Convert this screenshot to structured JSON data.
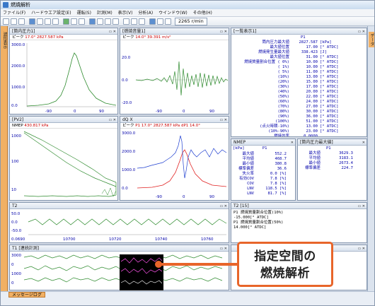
{
  "window": {
    "title": "燃焼解析"
  },
  "menu": [
    "ファイル(F)",
    "ハードウエア設定(E)",
    "運転(S)",
    "計測(M)",
    "表示(V)",
    "分析(A)",
    "ウインドウ(W)",
    "その他(H)"
  ],
  "toolbar": {
    "rpm": "2265 r/min"
  },
  "side_tabs": {
    "left": "波形表示",
    "right": "データ"
  },
  "panes": {
    "pressure": {
      "title": "[筒内圧力1]",
      "info_peak": "ピーク",
      "info_deg": "17.0°",
      "info_val": "2827.587 kPa",
      "y_ticks": [
        "3000.0",
        "2000.0",
        "1000.0",
        "0.0"
      ],
      "x_ticks": [
        "-90",
        "0",
        "90"
      ]
    },
    "vibration": {
      "title": "[燃焼音量1]",
      "info_peak": "ピーク",
      "info_deg": "14.0°",
      "info_val": "39.391 m/s²",
      "y_ticks": [
        "20.0",
        "0.0",
        "-20.0"
      ],
      "x_ticks": [
        "-90",
        "0",
        "90"
      ]
    },
    "pv": {
      "title": "[PV2]",
      "info_peak": "NMEP",
      "info_val": "430.817 kPa",
      "y_ticks": [
        "1000",
        "100",
        "10"
      ]
    },
    "dqx": {
      "title": "dQ X",
      "info_peak": "ピーク",
      "info_p1": "P1",
      "info_deg": "17.0°",
      "info_val": "2827.587 kPa",
      "info_dp": "dP1",
      "info_deg2": "14.0°",
      "y_ticks": [
        "3000.0",
        "2000.0",
        "1000.0",
        "0.0"
      ],
      "x_ticks": [
        "-90",
        "0",
        "90"
      ]
    },
    "t2": {
      "title": "T2",
      "y_ticks": [
        "50.0",
        "0.0",
        "-50.0"
      ],
      "x_ticks": [
        "0.0690",
        "10700",
        "10720",
        "10740",
        "10760"
      ]
    },
    "tlong": {
      "title": "T1 [連続計測]",
      "y_ticks": [
        "3000",
        "0",
        "1000",
        "0"
      ]
    },
    "list": {
      "title": "[一覧表示1]",
      "col": "P1"
    },
    "nmep": {
      "title": "NMEP",
      "col_unit": "[kPa]",
      "col": "P1"
    },
    "maxp": {
      "title": "[筒内圧力最大値]",
      "col": "P1"
    },
    "t2text": {
      "title": "T2 [15]"
    },
    "t2text2": {
      "title": ""
    }
  },
  "list_rows": [
    {
      "label": "筒内圧力最大値",
      "value": "2827.587",
      "unit": "[kPa]"
    },
    {
      "label": "最大値位置",
      "value": "17.00",
      "unit": "[° ATDC]"
    },
    {
      "label": "燃焼発生量最大値",
      "value": "338.423",
      "unit": "[J]"
    },
    {
      "label": "最大値位置",
      "value": "31.00",
      "unit": "[° ATDC]"
    },
    {
      "label": "燃焼質量割合位置 ( 0%)",
      "value": "10.00",
      "unit": "[° ATDC]"
    },
    {
      "label": "( 1%)",
      "value": "10.00",
      "unit": "[° ATDC]"
    },
    {
      "label": "( 5%)",
      "value": "11.00",
      "unit": "[° ATDC]"
    },
    {
      "label": "(10%)",
      "value": "13.00",
      "unit": "[° ATDC]"
    },
    {
      "label": "(20%)",
      "value": "15.00",
      "unit": "[° ATDC]"
    },
    {
      "label": "(30%)",
      "value": "17.00",
      "unit": "[° ATDC]"
    },
    {
      "label": "(40%)",
      "value": "20.00",
      "unit": "[° ATDC]"
    },
    {
      "label": "(50%)",
      "value": "22.00",
      "unit": "[° ATDC]"
    },
    {
      "label": "(60%)",
      "value": "24.00",
      "unit": "[° ATDC]"
    },
    {
      "label": "(70%)",
      "value": "27.00",
      "unit": "[° ATDC]"
    },
    {
      "label": "(80%)",
      "value": "30.00",
      "unit": "[° ATDC]"
    },
    {
      "label": "(90%)",
      "value": "36.00",
      "unit": "[° ATDC]"
    },
    {
      "label": "(100%)",
      "value": "51.00",
      "unit": "[° ATDC]"
    },
    {
      "label": "(点火時期-10%)",
      "value": "13.00",
      "unit": "[° ATDC]"
    },
    {
      "label": "(10%-90%)",
      "value": "23.00",
      "unit": "[° ATDC]"
    },
    {
      "label": "燃焼効率",
      "value": "0.0000",
      "unit": ""
    }
  ],
  "nmep_rows": [
    {
      "label": "最大値",
      "value": "552.2"
    },
    {
      "label": "平均値",
      "value": "468.7"
    },
    {
      "label": "最小値",
      "value": "380.8"
    },
    {
      "label": "標準偏差",
      "value": "36.6"
    },
    {
      "label": "失火率",
      "value": "0.0 [%]"
    },
    {
      "label": "有効COV",
      "value": "7.8 [%]"
    },
    {
      "label": "COV",
      "value": "7.8 [%]"
    },
    {
      "label": "LNV",
      "value": "118.5 [%]"
    },
    {
      "label": "LNV",
      "value": "81.7 [%]"
    }
  ],
  "maxp_rows": [
    {
      "label": "最大値",
      "value": "3629.3"
    },
    {
      "label": "平均値",
      "value": "3183.1"
    },
    {
      "label": "最小値",
      "value": "2673.4"
    },
    {
      "label": "標準偏差",
      "value": "224.7"
    }
  ],
  "t2_text": {
    "line1": "P1  燃焼質量割合位置(10%)",
    "line2": "   -15.000[° ATDC]",
    "line3": "P1  燃焼質量割合位置(50%)",
    "line4": "   14.000[° ATDC]"
  },
  "status": {
    "tab": "メッセージログ"
  },
  "callout": {
    "line1": "指定空間の",
    "line2": "燃焼解析"
  },
  "colors": {
    "pressure": "#2e8b2e",
    "dq_blue": "#1f3fd0",
    "dq_red": "#e02020",
    "accent": "#e8652a",
    "table_text": "#0000aa"
  }
}
